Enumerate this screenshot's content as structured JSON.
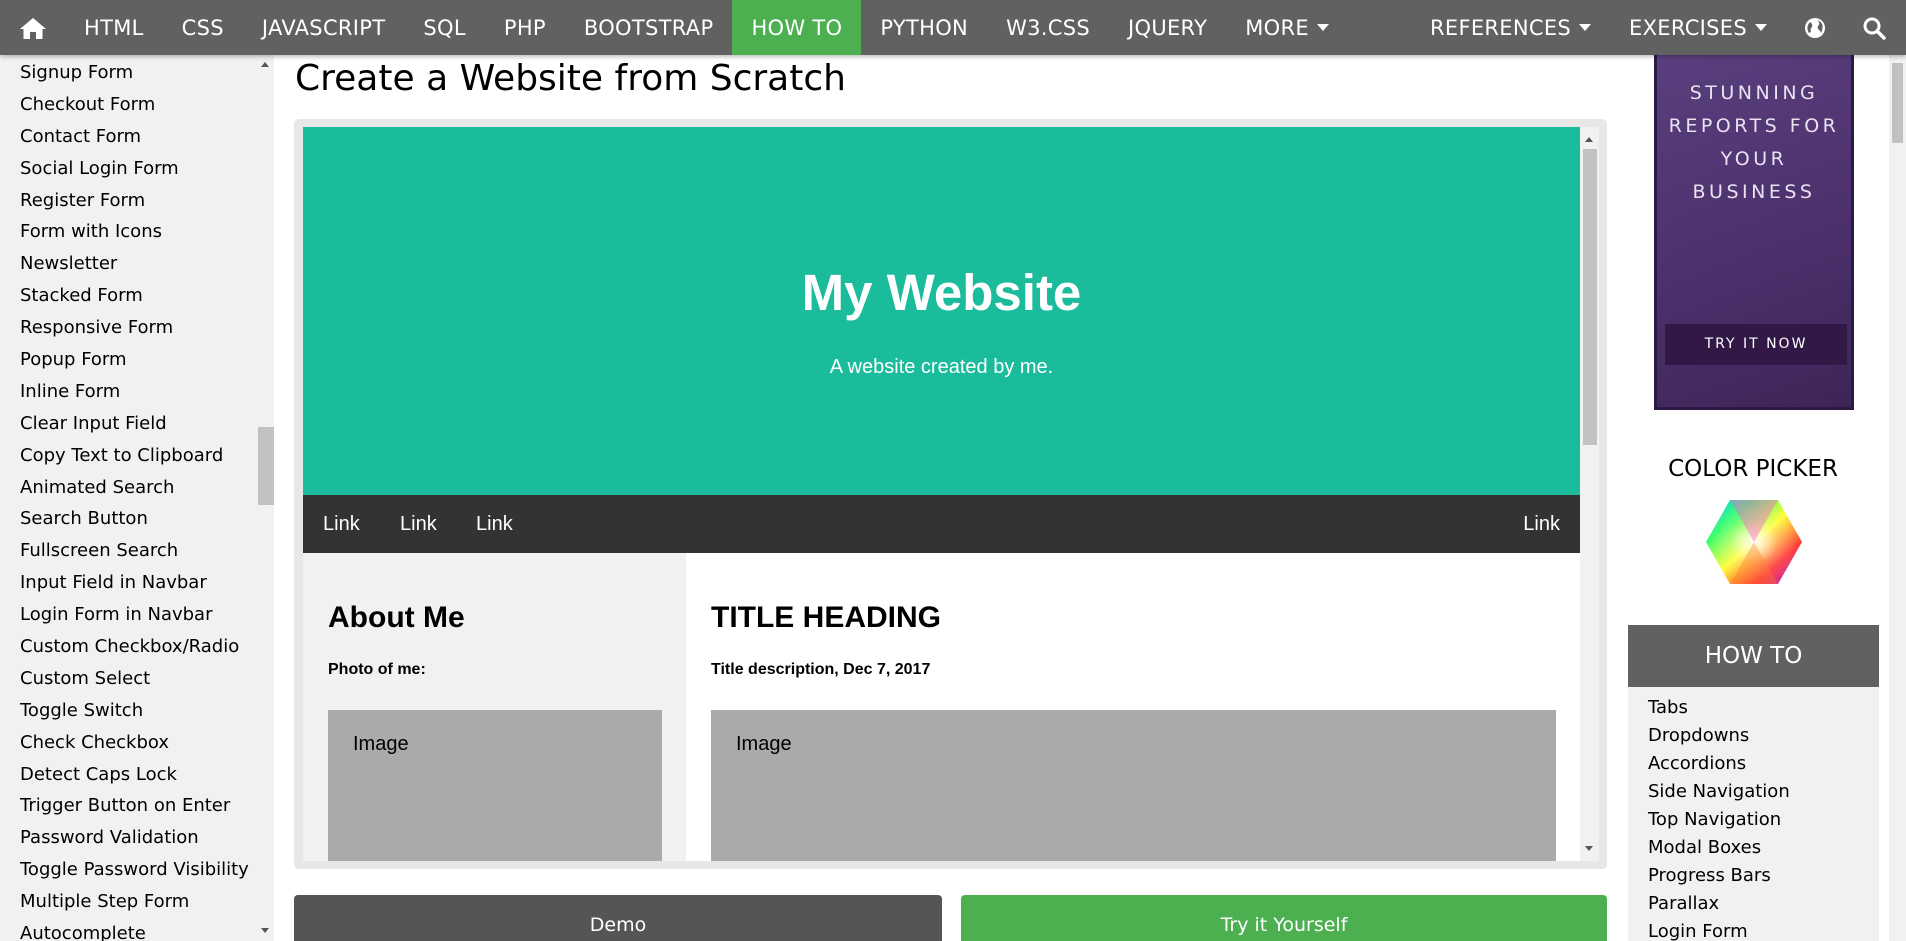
{
  "topnav": {
    "items": [
      {
        "label": "HTML"
      },
      {
        "label": "CSS"
      },
      {
        "label": "JAVASCRIPT"
      },
      {
        "label": "SQL"
      },
      {
        "label": "PHP"
      },
      {
        "label": "BOOTSTRAP"
      },
      {
        "label": "HOW TO",
        "active": true
      },
      {
        "label": "PYTHON"
      },
      {
        "label": "W3.CSS"
      },
      {
        "label": "JQUERY"
      },
      {
        "label": "MORE",
        "dropdown": true
      }
    ],
    "right_items": [
      {
        "label": "REFERENCES",
        "dropdown": true
      },
      {
        "label": "EXERCISES",
        "dropdown": true
      }
    ],
    "icons": [
      "home-icon",
      "globe-icon",
      "search-icon"
    ],
    "bar_color": "#616161",
    "active_color": "#4CAF50"
  },
  "sidebar": {
    "items": [
      "Signup Form",
      "Checkout Form",
      "Contact Form",
      "Social Login Form",
      "Register Form",
      "Form with Icons",
      "Newsletter",
      "Stacked Form",
      "Responsive Form",
      "Popup Form",
      "Inline Form",
      "Clear Input Field",
      "Copy Text to Clipboard",
      "Animated Search",
      "Search Button",
      "Fullscreen Search",
      "Input Field in Navbar",
      "Login Form in Navbar",
      "Custom Checkbox/Radio",
      "Custom Select",
      "Toggle Switch",
      "Check Checkbox",
      "Detect Caps Lock",
      "Trigger Button on Enter",
      "Password Validation",
      "Toggle Password Visibility",
      "Multiple Step Form",
      "Autocomplete"
    ]
  },
  "main": {
    "title": "Create a Website from Scratch",
    "example": {
      "header_title": "My Website",
      "header_subtitle": "A website created by me.",
      "header_color": "#1abc9c",
      "nav_links_left": [
        "Link",
        "Link",
        "Link"
      ],
      "nav_link_right": "Link",
      "side_heading": "About Me",
      "side_caption": "Photo of me:",
      "side_image_label": "Image",
      "main_heading": "TITLE HEADING",
      "main_caption": "Title description, Dec 7, 2017",
      "main_image_label": "Image"
    },
    "buttons": {
      "demo": "Demo",
      "try": "Try it Yourself"
    }
  },
  "right": {
    "ad": {
      "lines": [
        "STUNNING",
        "REPORTS FOR",
        "YOUR",
        "BUSINESS"
      ],
      "button": "TRY IT NOW"
    },
    "color_picker_title": "COLOR PICKER",
    "howto_title": "HOW TO",
    "howto_items": [
      "Tabs",
      "Dropdowns",
      "Accordions",
      "Side Navigation",
      "Top Navigation",
      "Modal Boxes",
      "Progress Bars",
      "Parallax",
      "Login Form"
    ]
  }
}
